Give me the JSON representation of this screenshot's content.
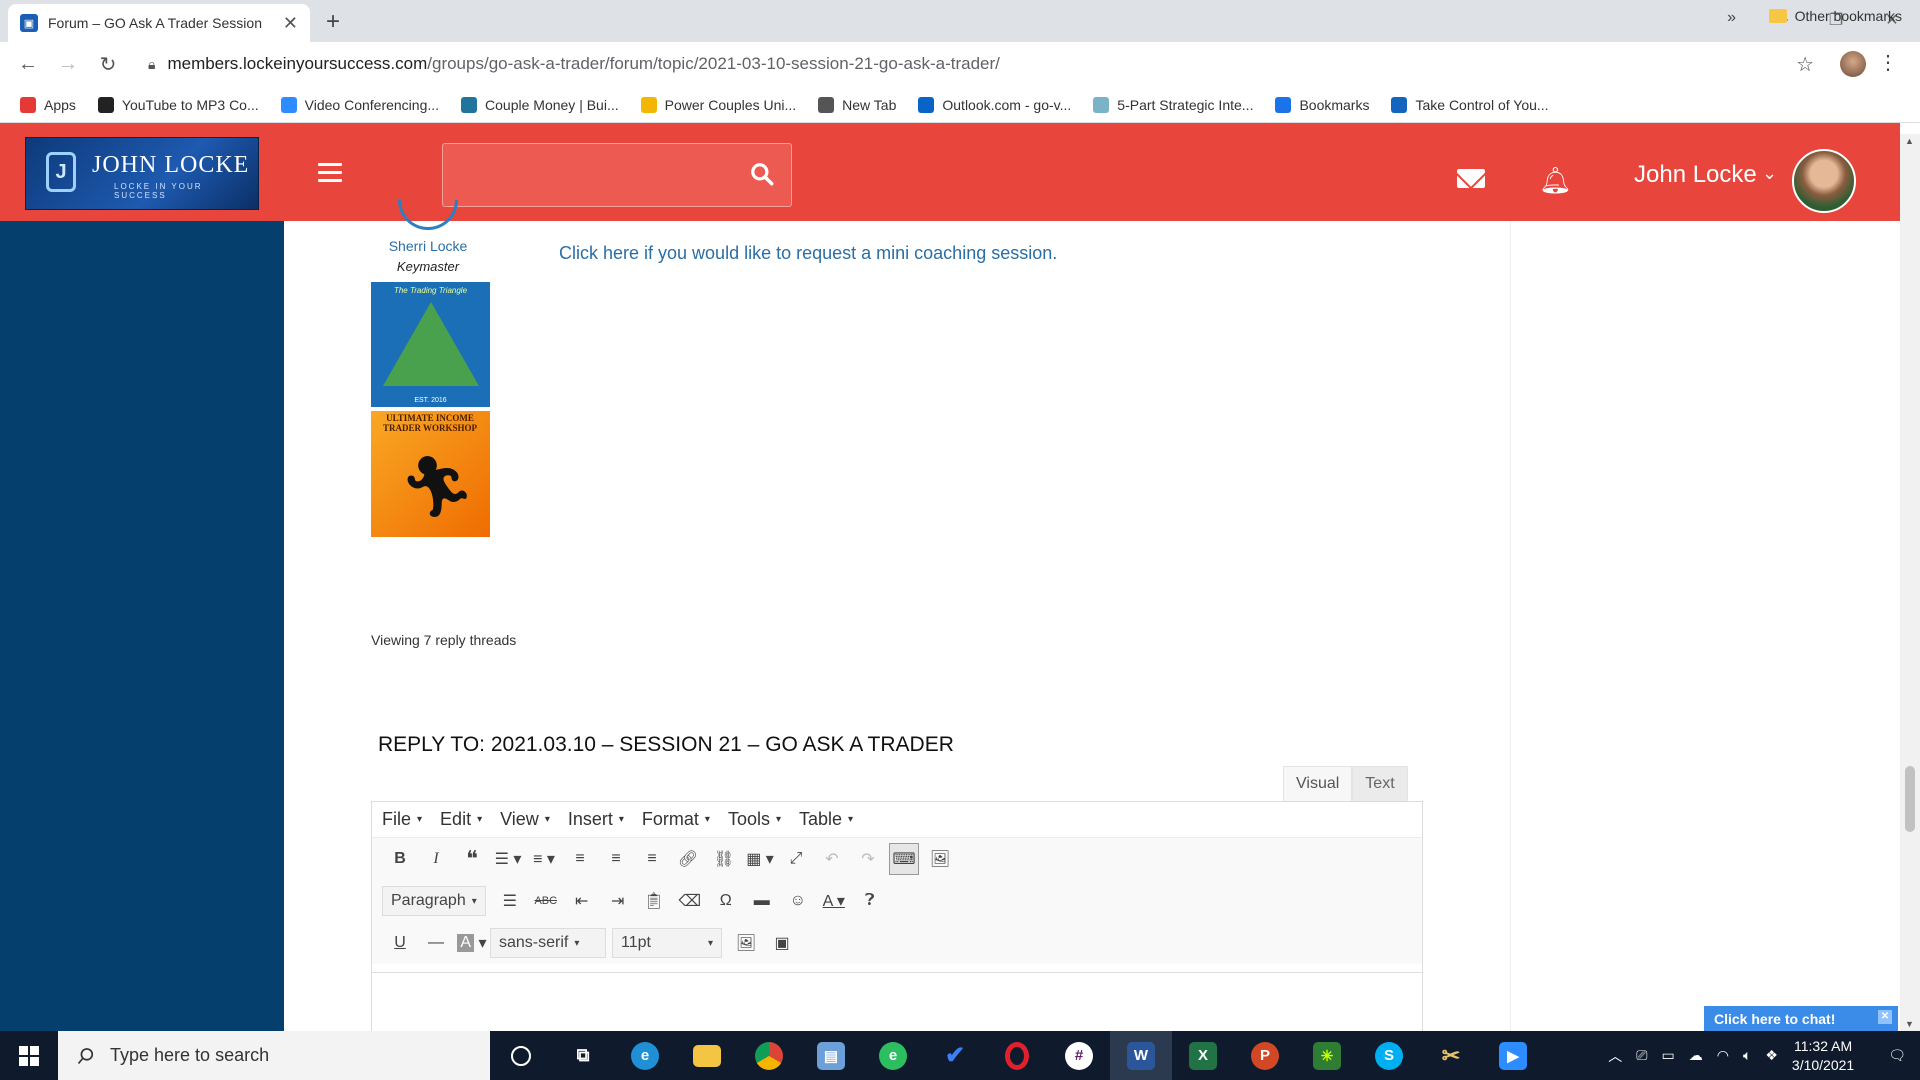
{
  "browser": {
    "tab_title": "Forum – GO Ask A Trader Session",
    "url_host": "members.lockeinyoursuccess.com",
    "url_path": "/groups/go-ask-a-trader/forum/topic/2021-03-10-session-21-go-ask-a-trader/",
    "bookmarks": [
      {
        "label": "Apps",
        "icon": "apps-grid-icon",
        "color": "#e53935"
      },
      {
        "label": "YouTube to MP3 Co...",
        "icon": "music-note-icon",
        "color": "#222222"
      },
      {
        "label": "Video Conferencing...",
        "icon": "zoom-icon",
        "color": "#2d8cff"
      },
      {
        "label": "Couple Money | Bui...",
        "icon": "wordpress-icon",
        "color": "#21759b"
      },
      {
        "label": "Power Couples Uni...",
        "icon": "bookmark-icon",
        "color": "#f2b705"
      },
      {
        "label": "New Tab",
        "icon": "globe-icon",
        "color": "#555555"
      },
      {
        "label": "Outlook.com - go-v...",
        "icon": "outlook-icon",
        "color": "#0a64c8"
      },
      {
        "label": "5-Part Strategic Inte...",
        "icon": "circle-icon",
        "color": "#7ab3c7"
      },
      {
        "label": "Bookmarks",
        "icon": "star-icon",
        "color": "#1a73e8"
      },
      {
        "label": "Take Control of You...",
        "icon": "circle-icon",
        "color": "#1565c0"
      }
    ],
    "more": "»",
    "other_bookmarks": "Other bookmarks"
  },
  "site": {
    "logo_name": "JOHN LOCKE",
    "logo_tagline": "LOCKE IN YOUR SUCCESS",
    "user_name": "John Locke",
    "accent": "#e8453c",
    "sidebar_color": "#053f6d"
  },
  "post": {
    "author_name": "Sherri Locke",
    "author_role": "Keymaster",
    "badge1_title": "The Trading Triangle",
    "badge1_year": "EST. 2016",
    "badge2_title": "ULTIMATE INCOME TRADER WORKSHOP",
    "coaching_link": "Click here if you would like to request a mini coaching session.",
    "viewing": "Viewing 7 reply threads"
  },
  "reply": {
    "title": "REPLY TO: 2021.03.10 – SESSION 21 – GO ASK A TRADER",
    "tab_visual": "Visual",
    "tab_text": "Text",
    "menus": [
      "File",
      "Edit",
      "View",
      "Insert",
      "Format",
      "Tools",
      "Table"
    ],
    "paragraph": "Paragraph",
    "font": "sans-serif",
    "size": "11pt"
  },
  "chat": {
    "label": "Click here to chat!"
  },
  "taskbar": {
    "search_placeholder": "Type here to search",
    "time": "11:32 AM",
    "date": "3/10/2021"
  }
}
